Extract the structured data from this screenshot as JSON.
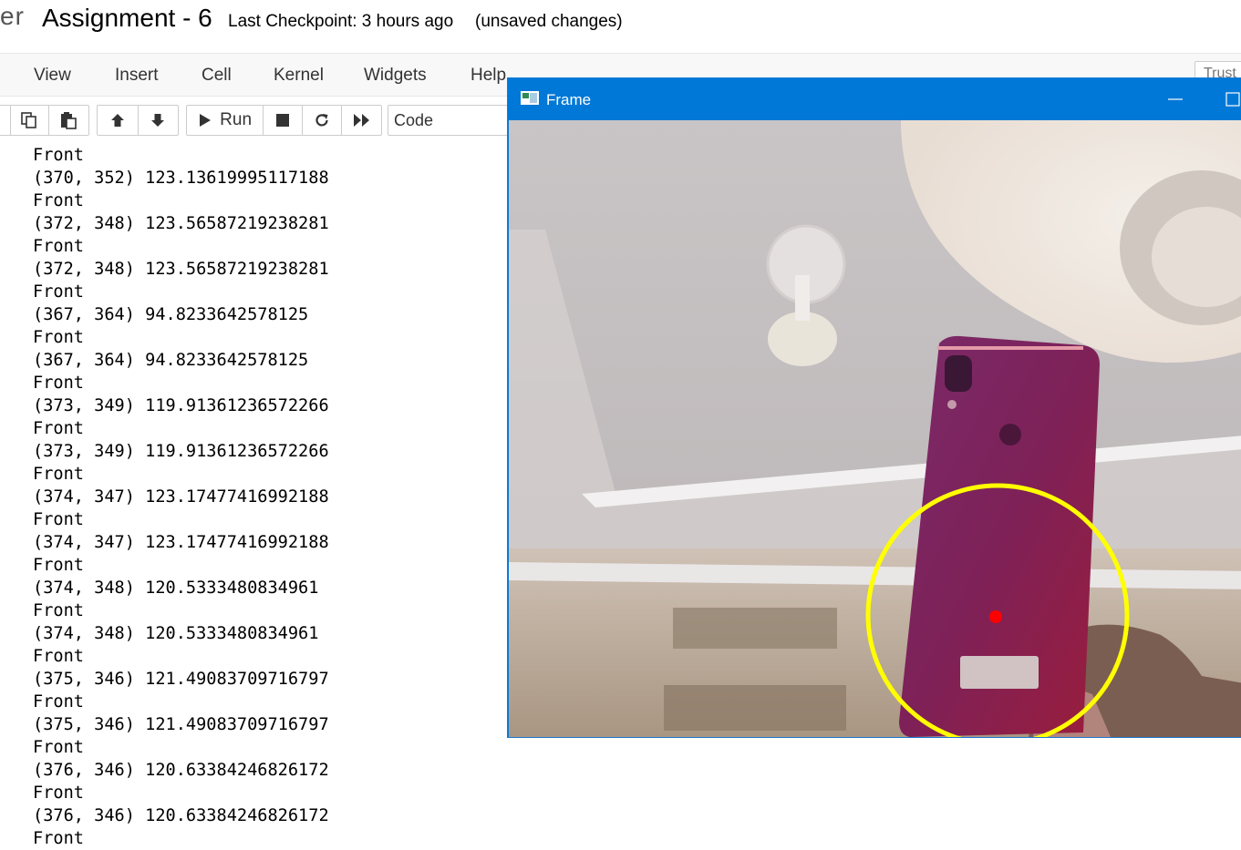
{
  "header": {
    "logo_fragment": "er",
    "notebook_title": "Assignment - 6",
    "checkpoint": "Last Checkpoint: 3 hours ago",
    "save_status": "(unsaved changes)"
  },
  "menu": [
    "View",
    "Insert",
    "Cell",
    "Kernel",
    "Widgets",
    "Help"
  ],
  "trusted_label": "Trust",
  "toolbar": {
    "copy_icon": "copy-icon",
    "paste_icon": "paste-icon",
    "move_up_icon": "arrow-up-icon",
    "move_down_icon": "arrow-down-icon",
    "run_label": "Run",
    "stop_icon": "stop-icon",
    "restart_icon": "restart-icon",
    "fast_forward_icon": "fast-forward-icon",
    "cell_type": "Code"
  },
  "output_lines": [
    "Front",
    "(370, 352) 123.13619995117188",
    "Front",
    "(372, 348) 123.56587219238281",
    "Front",
    "(372, 348) 123.56587219238281",
    "Front",
    "(367, 364) 94.8233642578125",
    "Front",
    "(367, 364) 94.8233642578125",
    "Front",
    "(373, 349) 119.91361236572266",
    "Front",
    "(373, 349) 119.91361236572266",
    "Front",
    "(374, 347) 123.17477416992188",
    "Front",
    "(374, 347) 123.17477416992188",
    "Front",
    "(374, 348) 120.5333480834961",
    "Front",
    "(374, 348) 120.5333480834961",
    "Front",
    "(375, 346) 121.49083709716797",
    "Front",
    "(375, 346) 121.49083709716797",
    "Front",
    "(376, 346) 120.63384246826172",
    "Front",
    "(376, 346) 120.63384246826172",
    "Front"
  ],
  "cv_window": {
    "title": "Frame",
    "accent": "#0078d7",
    "circle_color": "#ffff00",
    "center_dot_color": "#ff0000"
  }
}
